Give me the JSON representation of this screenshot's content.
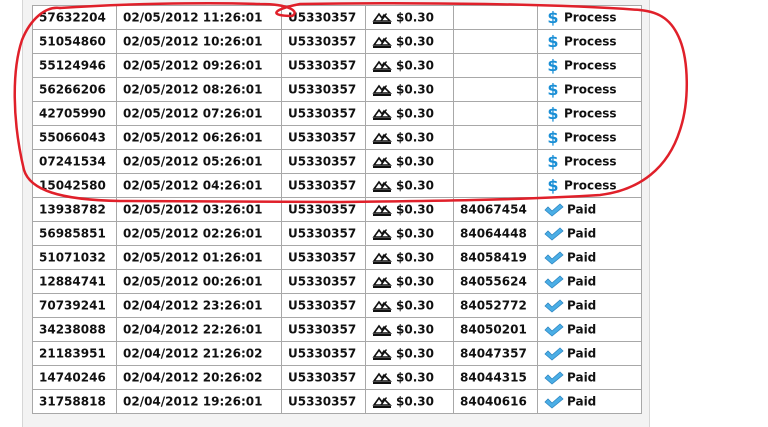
{
  "transactions": {
    "rows": [
      {
        "id": "57632204",
        "datetime": "02/05/2012 11:26:01",
        "user": "U5330357",
        "amount": "$0.30",
        "ref": "",
        "status": "Process",
        "status_type": "process"
      },
      {
        "id": "51054860",
        "datetime": "02/05/2012 10:26:01",
        "user": "U5330357",
        "amount": "$0.30",
        "ref": "",
        "status": "Process",
        "status_type": "process"
      },
      {
        "id": "55124946",
        "datetime": "02/05/2012 09:26:01",
        "user": "U5330357",
        "amount": "$0.30",
        "ref": "",
        "status": "Process",
        "status_type": "process"
      },
      {
        "id": "56266206",
        "datetime": "02/05/2012 08:26:01",
        "user": "U5330357",
        "amount": "$0.30",
        "ref": "",
        "status": "Process",
        "status_type": "process"
      },
      {
        "id": "42705990",
        "datetime": "02/05/2012 07:26:01",
        "user": "U5330357",
        "amount": "$0.30",
        "ref": "",
        "status": "Process",
        "status_type": "process"
      },
      {
        "id": "55066043",
        "datetime": "02/05/2012 06:26:01",
        "user": "U5330357",
        "amount": "$0.30",
        "ref": "",
        "status": "Process",
        "status_type": "process"
      },
      {
        "id": "07241534",
        "datetime": "02/05/2012 05:26:01",
        "user": "U5330357",
        "amount": "$0.30",
        "ref": "",
        "status": "Process",
        "status_type": "process"
      },
      {
        "id": "15042580",
        "datetime": "02/05/2012 04:26:01",
        "user": "U5330357",
        "amount": "$0.30",
        "ref": "",
        "status": "Process",
        "status_type": "process"
      },
      {
        "id": "13938782",
        "datetime": "02/05/2012 03:26:01",
        "user": "U5330357",
        "amount": "$0.30",
        "ref": "84067454",
        "status": "Paid",
        "status_type": "paid"
      },
      {
        "id": "56985851",
        "datetime": "02/05/2012 02:26:01",
        "user": "U5330357",
        "amount": "$0.30",
        "ref": "84064448",
        "status": "Paid",
        "status_type": "paid"
      },
      {
        "id": "51071032",
        "datetime": "02/05/2012 01:26:01",
        "user": "U5330357",
        "amount": "$0.30",
        "ref": "84058419",
        "status": "Paid",
        "status_type": "paid"
      },
      {
        "id": "12884741",
        "datetime": "02/05/2012 00:26:01",
        "user": "U5330357",
        "amount": "$0.30",
        "ref": "84055624",
        "status": "Paid",
        "status_type": "paid"
      },
      {
        "id": "70739241",
        "datetime": "02/04/2012 23:26:01",
        "user": "U5330357",
        "amount": "$0.30",
        "ref": "84052772",
        "status": "Paid",
        "status_type": "paid"
      },
      {
        "id": "34238088",
        "datetime": "02/04/2012 22:26:01",
        "user": "U5330357",
        "amount": "$0.30",
        "ref": "84050201",
        "status": "Paid",
        "status_type": "paid"
      },
      {
        "id": "21183951",
        "datetime": "02/04/2012 21:26:02",
        "user": "U5330357",
        "amount": "$0.30",
        "ref": "84047357",
        "status": "Paid",
        "status_type": "paid"
      },
      {
        "id": "14740246",
        "datetime": "02/04/2012 20:26:02",
        "user": "U5330357",
        "amount": "$0.30",
        "ref": "84044315",
        "status": "Paid",
        "status_type": "paid"
      },
      {
        "id": "31758818",
        "datetime": "02/04/2012 19:26:01",
        "user": "U5330357",
        "amount": "$0.30",
        "ref": "84040616",
        "status": "Paid",
        "status_type": "paid"
      }
    ]
  },
  "icons": {
    "process": "dollar-icon",
    "paid": "checkmark-icon",
    "method": "payment-method-icon"
  },
  "colors": {
    "process_icon": "#1a8fd6",
    "paid_icon": "#4aaee6",
    "annotation": "#e0202a",
    "cell_border": "#a8a8a8"
  }
}
